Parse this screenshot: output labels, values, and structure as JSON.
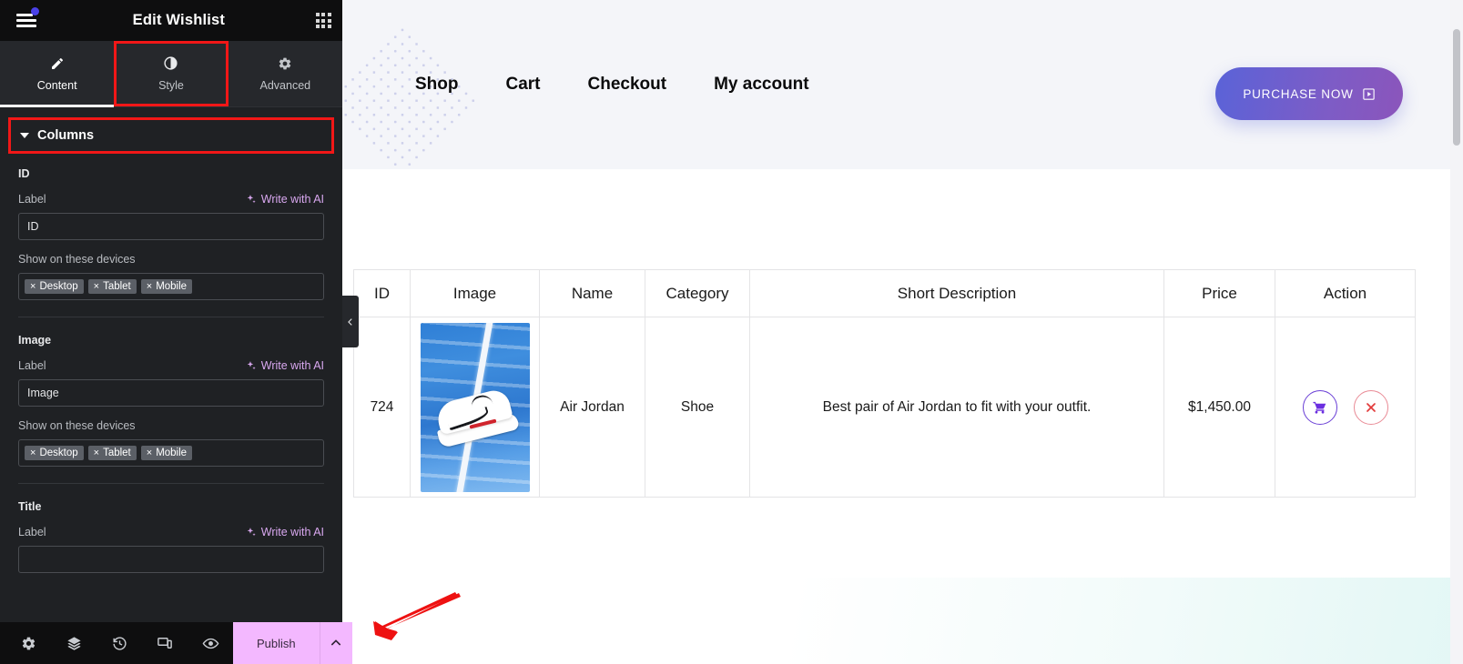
{
  "panel": {
    "header": {
      "menu_icon": "hamburger-icon",
      "title": "Edit Wishlist",
      "apps_icon": "grid-apps-icon"
    },
    "tabs": [
      {
        "label": "Content",
        "icon": "pencil-icon",
        "active": true,
        "highlighted": false
      },
      {
        "label": "Style",
        "icon": "contrast-icon",
        "active": false,
        "highlighted": true
      },
      {
        "label": "Advanced",
        "icon": "gear-icon",
        "active": false,
        "highlighted": false
      }
    ],
    "section": {
      "title": "Columns",
      "expanded": true,
      "highlighted": true
    },
    "ai_link_label": "Write with AI",
    "label_caption": "Label",
    "devices_caption": "Show on these devices",
    "device_chips": [
      "Desktop",
      "Tablet",
      "Mobile"
    ],
    "chip_remove_glyph": "×",
    "fields": [
      {
        "group": "ID",
        "label_value": "ID"
      },
      {
        "group": "Image",
        "label_value": "Image"
      },
      {
        "group": "Title",
        "label_value": ""
      }
    ],
    "footer": {
      "icons": [
        "settings-gear-icon",
        "navigator-layers-icon",
        "history-icon",
        "responsive-device-icon",
        "preview-eye-icon"
      ],
      "publish_label": "Publish",
      "publish_caret_icon": "chevron-up-icon"
    }
  },
  "canvas": {
    "nav_links": [
      "Shop",
      "Cart",
      "Checkout",
      "My account"
    ],
    "cta_label": "PURCHASE NOW",
    "cta_icon": "play-box-icon",
    "collapse_icon": "chevron-left-icon",
    "table": {
      "headers": [
        "ID",
        "Image",
        "Name",
        "Category",
        "Short Description",
        "Price",
        "Action"
      ],
      "rows": [
        {
          "id": "724",
          "image_alt": "white-sneaker-on-blue-court",
          "name": "Air Jordan",
          "category": "Shoe",
          "short_description": "Best pair of Air Jordan to fit with your outfit.",
          "price": "$1,450.00",
          "actions": [
            "add-to-cart-icon",
            "remove-icon"
          ]
        }
      ]
    }
  },
  "colors": {
    "panel_bg": "#1f2124",
    "panel_header_bg": "#0e0e0f",
    "tab_bg": "#26282c",
    "highlight_outline": "#f11717",
    "publish_bg": "#f3b8ff",
    "ai_link": "#d9a8f0",
    "notification_dot": "#4a41e8",
    "cta_gradient_from": "#5a63d8",
    "cta_gradient_to": "#8b55bb",
    "cart_icon": "#6b2fe0",
    "delete_icon": "#e23b3b",
    "site_header_bg": "#f4f5f9",
    "annotation_arrow": "#ee1111"
  }
}
